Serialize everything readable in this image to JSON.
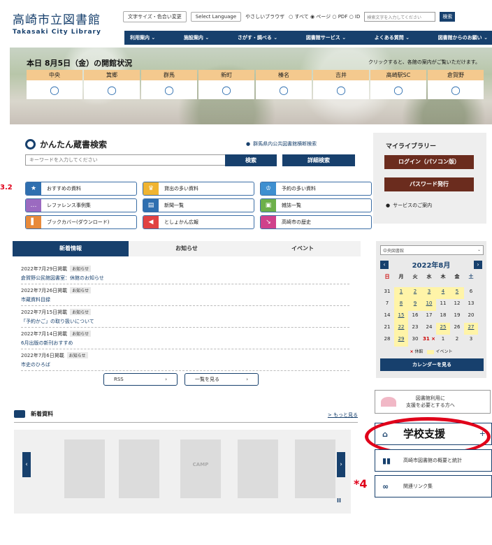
{
  "header": {
    "logo_ja": "高崎市立図書館",
    "logo_en": "Takasaki City Library",
    "font_size_btn": "文字サイズ・色合い変更",
    "language_btn": "Select Language",
    "easy_label": "やさしいブラウザ",
    "scope_radios": "○ すべて ◉ ページ ○ PDF ○ ID",
    "search_placeholder": "検索文字を入力してください",
    "search_btn": "検索",
    "nav": [
      "利用案内 ⌄",
      "施設案内 ⌄",
      "さがす・調べる ⌄",
      "図書館サービス ⌄",
      "よくある質問 ⌄",
      "図書館からのお願い ⌄"
    ]
  },
  "hero": {
    "title": "本日 8月5日（金）の開館状況",
    "hint": "クリックすると、各館の案内がご覧いただけます。",
    "branches": [
      {
        "name": "中央",
        "status": "○"
      },
      {
        "name": "箕郷",
        "status": "○"
      },
      {
        "name": "群馬",
        "status": "○"
      },
      {
        "name": "新町",
        "status": "○"
      },
      {
        "name": "榛名",
        "status": "○"
      },
      {
        "name": "吉井",
        "status": "○"
      },
      {
        "name": "高崎駅SC",
        "status": "○"
      },
      {
        "name": "倉賀野",
        "status": "○"
      }
    ]
  },
  "search": {
    "title": "かんたん蔵書検索",
    "union_link": "群馬県内公共図書館横断検索",
    "placeholder": "キーワードを入力してください",
    "search_btn": "検索",
    "advanced_btn": "詳細検索",
    "quick_links": [
      {
        "label": "おすすめの資料",
        "color": "#2f6fb0",
        "icon": "★"
      },
      {
        "label": "貸出の多い資料",
        "color": "#f0b431",
        "icon": "♛"
      },
      {
        "label": "予約の多い資料",
        "color": "#3e8fd0",
        "icon": "♔"
      },
      {
        "label": "レファレンス事例集",
        "color": "#9b6ac0",
        "icon": "…"
      },
      {
        "label": "新聞一覧",
        "color": "#2f6fb0",
        "icon": "▤"
      },
      {
        "label": "雑誌一覧",
        "color": "#6db04a",
        "icon": "▣"
      },
      {
        "label": "ブックカバー(ダウンロード)",
        "color": "#e88a3a",
        "icon": "▌"
      },
      {
        "label": "としょかん広報",
        "color": "#e14242",
        "icon": "◀"
      },
      {
        "label": "高崎市の歴史",
        "color": "#d0418b",
        "icon": "↘"
      }
    ]
  },
  "mylibrary": {
    "title": "マイライブラリー",
    "login_btn": "ログイン（パソコン版）",
    "password_btn": "パスワード発行",
    "guide": "サービスのご案内"
  },
  "tabs": [
    "新着情報",
    "お知らせ",
    "イベント"
  ],
  "news": [
    {
      "date": "2022年7月29日掲載",
      "category": "お知らせ",
      "text": "倉賀野公民館図書室：休館のお知らせ"
    },
    {
      "date": "2022年7月26日掲載",
      "category": "お知らせ",
      "text": "市蔵資料目録"
    },
    {
      "date": "2022年7月15日掲載",
      "category": "お知らせ",
      "text": "「予約かご」の取り扱いについて"
    },
    {
      "date": "2022年7月14日掲載",
      "category": "お知らせ",
      "text": "6月出版の新刊おすすめ"
    },
    {
      "date": "2022年7月6日掲載",
      "category": "お知らせ",
      "text": "市史のひろば"
    }
  ],
  "news_buttons": {
    "rss": "RSS",
    "list": "一覧を見る",
    "arrow": "›"
  },
  "calendar": {
    "library_select": "中央図書館",
    "month": "2022年8月",
    "weekdays": [
      "日",
      "月",
      "火",
      "水",
      "木",
      "金",
      "土"
    ],
    "days": [
      {
        "d": "31",
        "t": ""
      },
      {
        "d": "1",
        "t": "ev"
      },
      {
        "d": "2",
        "t": "ev"
      },
      {
        "d": "3",
        "t": "ev"
      },
      {
        "d": "4",
        "t": "ev"
      },
      {
        "d": "5",
        "t": "ev"
      },
      {
        "d": "6",
        "t": ""
      },
      {
        "d": "7",
        "t": ""
      },
      {
        "d": "8",
        "t": "ev"
      },
      {
        "d": "9",
        "t": "ev"
      },
      {
        "d": "10",
        "t": "ev"
      },
      {
        "d": "11",
        "t": ""
      },
      {
        "d": "12",
        "t": ""
      },
      {
        "d": "13",
        "t": ""
      },
      {
        "d": "14",
        "t": ""
      },
      {
        "d": "15",
        "t": "ev"
      },
      {
        "d": "16",
        "t": ""
      },
      {
        "d": "17",
        "t": ""
      },
      {
        "d": "18",
        "t": ""
      },
      {
        "d": "19",
        "t": ""
      },
      {
        "d": "20",
        "t": ""
      },
      {
        "d": "21",
        "t": ""
      },
      {
        "d": "22",
        "t": "ev"
      },
      {
        "d": "23",
        "t": ""
      },
      {
        "d": "24",
        "t": ""
      },
      {
        "d": "25",
        "t": "ev"
      },
      {
        "d": "26",
        "t": ""
      },
      {
        "d": "27",
        "t": "ev"
      },
      {
        "d": "28",
        "t": ""
      },
      {
        "d": "29",
        "t": "ev"
      },
      {
        "d": "30",
        "t": ""
      },
      {
        "d": "31 ×",
        "t": "cl"
      },
      {
        "d": "1",
        "t": ""
      },
      {
        "d": "2",
        "t": ""
      },
      {
        "d": "3",
        "t": ""
      }
    ],
    "legend_closed": "休館",
    "legend_event": "イベント",
    "view_btn": "カレンダーを見る"
  },
  "side_links": {
    "support_text": "図書館利用に\n支援を必要とする方へ",
    "school_support": "学校支援",
    "overview": "高崎市図書館の概要と統計",
    "links": "関連リンク集"
  },
  "annotations": {
    "side_mark": "3.2",
    "note4": "*4"
  },
  "arrivals": {
    "title": "新着資料",
    "more": "> もっと見る",
    "books": [
      "",
      "",
      "CAMP",
      "",
      "",
      ""
    ]
  }
}
